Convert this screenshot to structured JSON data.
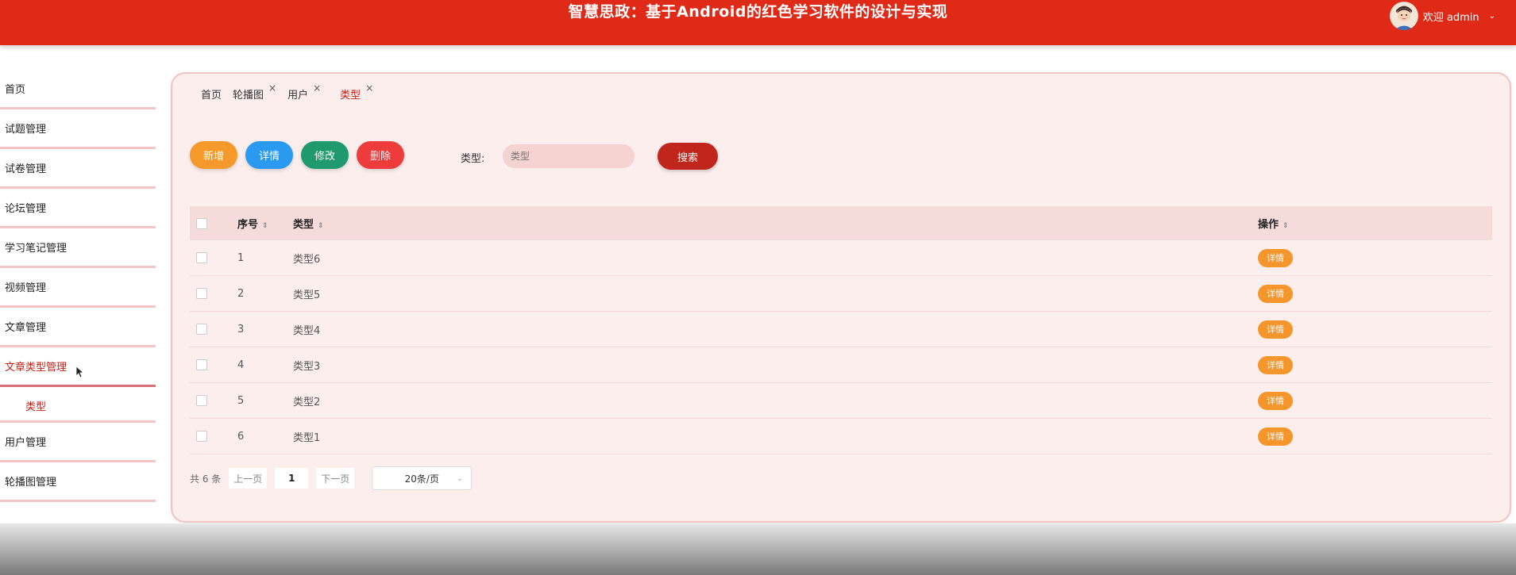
{
  "header": {
    "title": "智慧思政：基于Android的红色学习软件的设计与实现",
    "welcome": "欢迎 admin",
    "brand_color": "#df2a18"
  },
  "sidebar": {
    "items": [
      {
        "label": "首页"
      },
      {
        "label": "试题管理"
      },
      {
        "label": "试卷管理"
      },
      {
        "label": "论坛管理"
      },
      {
        "label": "学习笔记管理"
      },
      {
        "label": "视频管理"
      },
      {
        "label": "文章管理"
      },
      {
        "label": "文章类型管理",
        "active": true
      },
      {
        "label": "用户管理"
      },
      {
        "label": "轮播图管理"
      }
    ],
    "sub_item": "类型"
  },
  "tabs": [
    {
      "label": "首页"
    },
    {
      "label": "轮播图",
      "close": "×"
    },
    {
      "label": "用户",
      "close": "×"
    },
    {
      "label": "类型",
      "close": "×",
      "active": true
    }
  ],
  "toolbar": {
    "add": "新增",
    "detail": "详情",
    "edit": "修改",
    "delete": "删除",
    "search_label": "类型:",
    "search_placeholder": "类型",
    "search_button": "搜索"
  },
  "table": {
    "headers": {
      "no": "序号",
      "type": "类型",
      "ops": "操作"
    },
    "rows": [
      {
        "no": "1",
        "type": "类型6",
        "action": "详情"
      },
      {
        "no": "2",
        "type": "类型5",
        "action": "详情"
      },
      {
        "no": "3",
        "type": "类型4",
        "action": "详情"
      },
      {
        "no": "4",
        "type": "类型3",
        "action": "详情"
      },
      {
        "no": "5",
        "type": "类型2",
        "action": "详情"
      },
      {
        "no": "6",
        "type": "类型1",
        "action": "详情"
      }
    ]
  },
  "pagination": {
    "total": "共 6 条",
    "prev": "上一页",
    "page": "1",
    "next": "下一页",
    "page_size": "20条/页"
  },
  "icons": [
    "user-avatar",
    "chevron-down-icon",
    "close-icon",
    "sort-icon",
    "mouse-cursor-icon"
  ]
}
